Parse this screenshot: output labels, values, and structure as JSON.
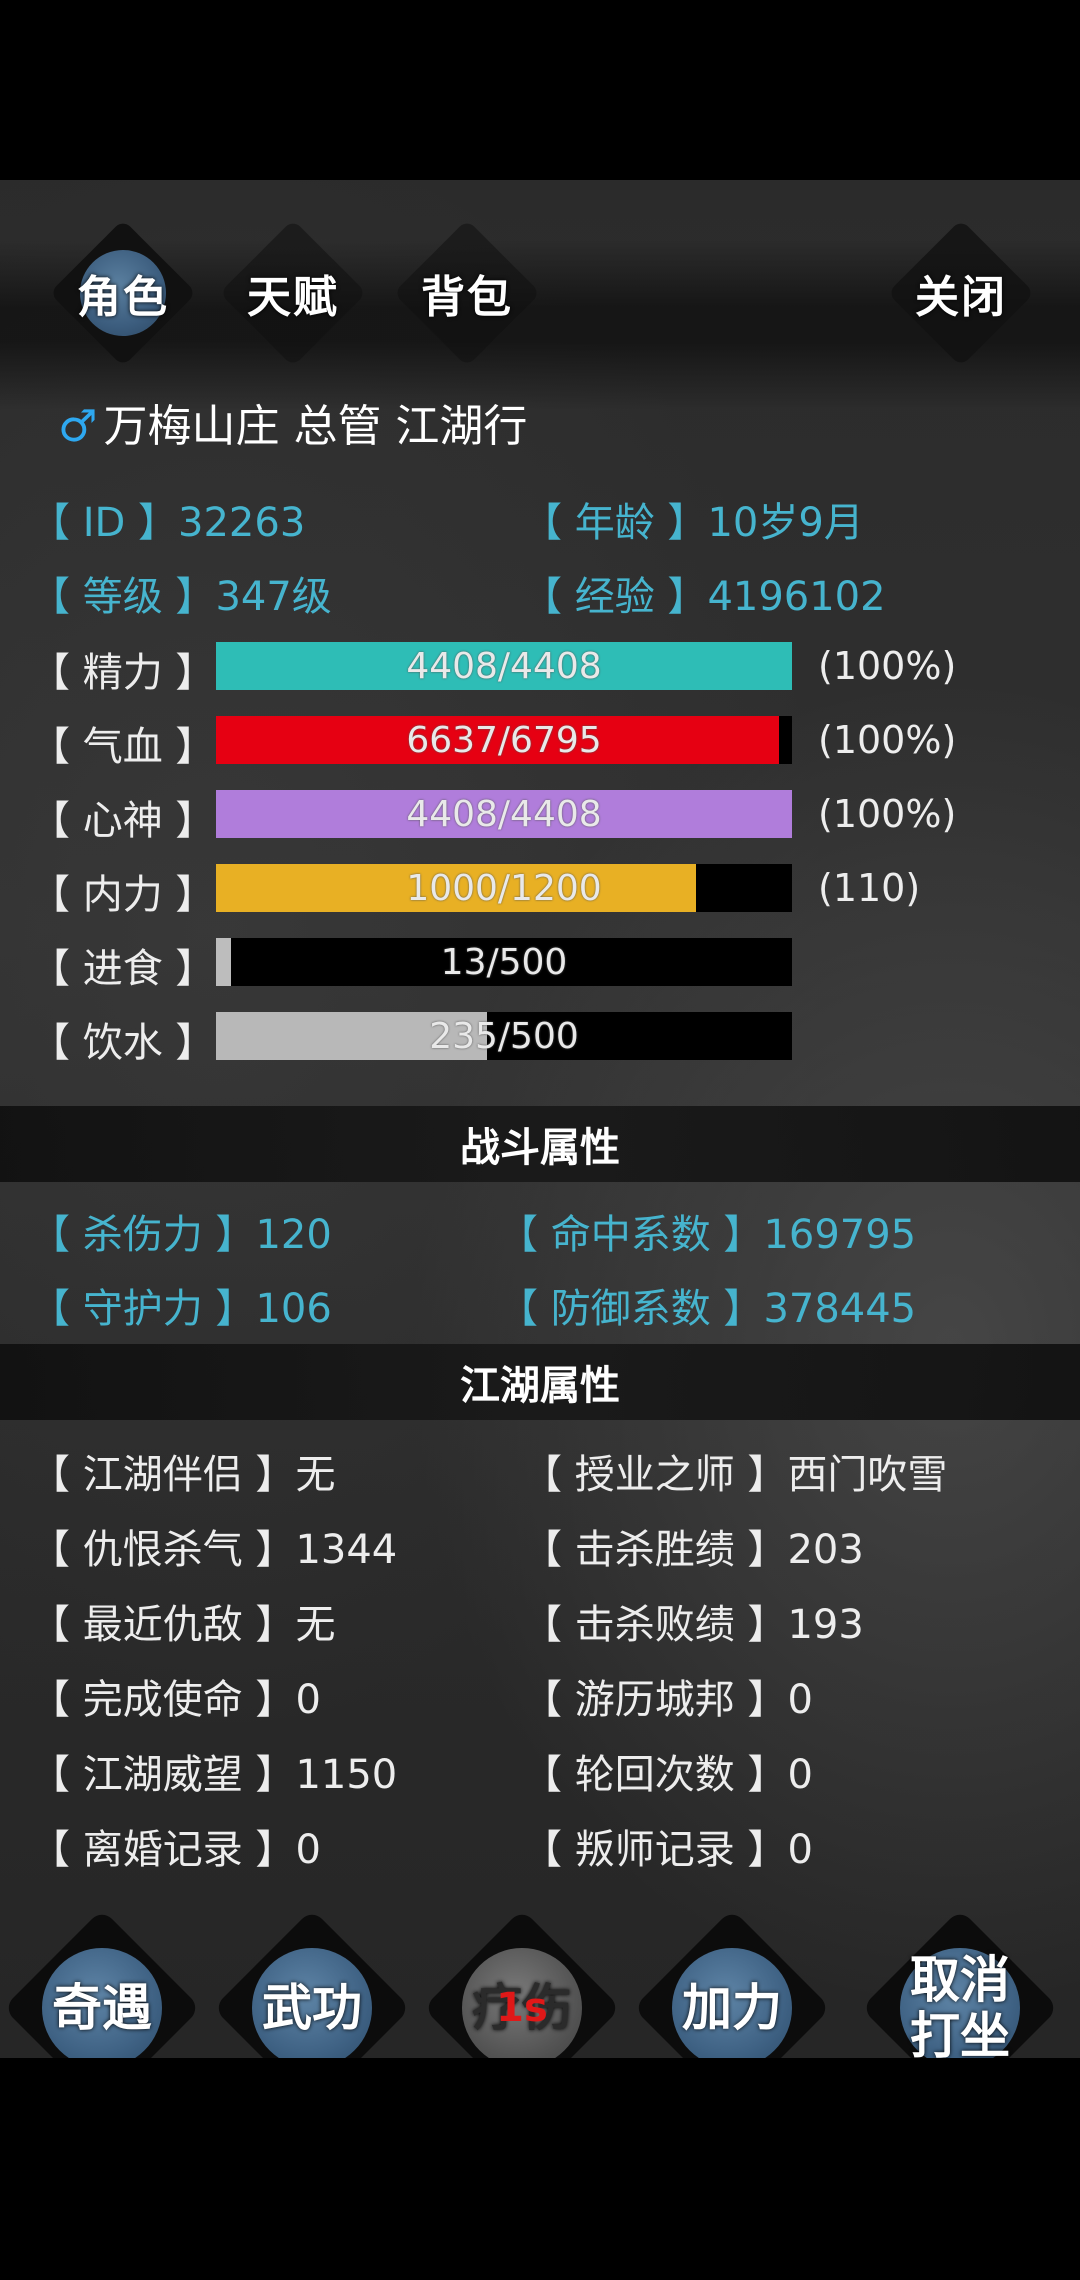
{
  "tabs": [
    {
      "label": "角色",
      "active": true
    },
    {
      "label": "天赋",
      "active": false
    },
    {
      "label": "背包",
      "active": false
    }
  ],
  "close_label": "关闭",
  "profile": {
    "gender_symbol": "♂",
    "title": "万梅山庄 总管 江湖行"
  },
  "basic": {
    "id_label": "【  ID  】",
    "id_value": "32263",
    "age_label": "【 年龄 】",
    "age_value": "10岁9月",
    "level_label": "【 等级 】",
    "level_value": "347级",
    "exp_label": "【 经验 】",
    "exp_value": "4196102"
  },
  "bars": [
    {
      "label": "【 精力 】",
      "text": "4408/4408",
      "fraction": 1.0,
      "color": "#2ebdb6",
      "pct": "(100%)"
    },
    {
      "label": "【 气血 】",
      "text": "6637/6795",
      "fraction": 0.977,
      "color": "#e60012",
      "pct": "(100%)"
    },
    {
      "label": "【 心神 】",
      "text": "4408/4408",
      "fraction": 1.0,
      "color": "#b07ddb",
      "pct": "(100%)"
    },
    {
      "label": "【 内力 】",
      "text": "1000/1200",
      "fraction": 0.833,
      "color": "#e8b024",
      "pct": "(110)"
    },
    {
      "label": "【 进食 】",
      "text": "13/500",
      "fraction": 0.026,
      "color": "#bdbdbd",
      "pct": ""
    },
    {
      "label": "【 饮水 】",
      "text": "235/500",
      "fraction": 0.47,
      "color": "#b8b8b8",
      "pct": ""
    }
  ],
  "combat": {
    "title": "战斗属性",
    "kill_label": "【 杀伤力 】",
    "kill_value": "120",
    "hit_label": "【 命中系数 】",
    "hit_value": "169795",
    "guard_label": "【 守护力 】",
    "guard_value": "106",
    "def_label": "【 防御系数 】",
    "def_value": "378445"
  },
  "jianghu": {
    "title": "江湖属性",
    "rows": [
      {
        "l_label": "【 江湖伴侣 】",
        "l_value": "无",
        "r_label": "【 授业之师 】",
        "r_value": "西门吹雪"
      },
      {
        "l_label": "【 仇恨杀气 】",
        "l_value": "1344",
        "r_label": "【 击杀胜绩 】",
        "r_value": "203"
      },
      {
        "l_label": "【 最近仇敌 】",
        "l_value": "无",
        "r_label": "【 击杀败绩 】",
        "r_value": "193"
      },
      {
        "l_label": "【 完成使命 】",
        "l_value": "0",
        "r_label": "【 游历城邦 】",
        "r_value": "0"
      },
      {
        "l_label": "【 江湖威望 】",
        "l_value": "1150",
        "r_label": "【 轮回次数 】",
        "r_value": "0"
      },
      {
        "l_label": "【 离婚记录 】",
        "l_value": "0",
        "r_label": "【 叛师记录 】",
        "r_value": "0"
      }
    ]
  },
  "bottom": {
    "adventure": "奇遇",
    "martial": "武功",
    "training": "疗伤",
    "training_timer": "1s",
    "power": "加力",
    "cancel_line1": "取消",
    "cancel_line2": "打坐"
  }
}
